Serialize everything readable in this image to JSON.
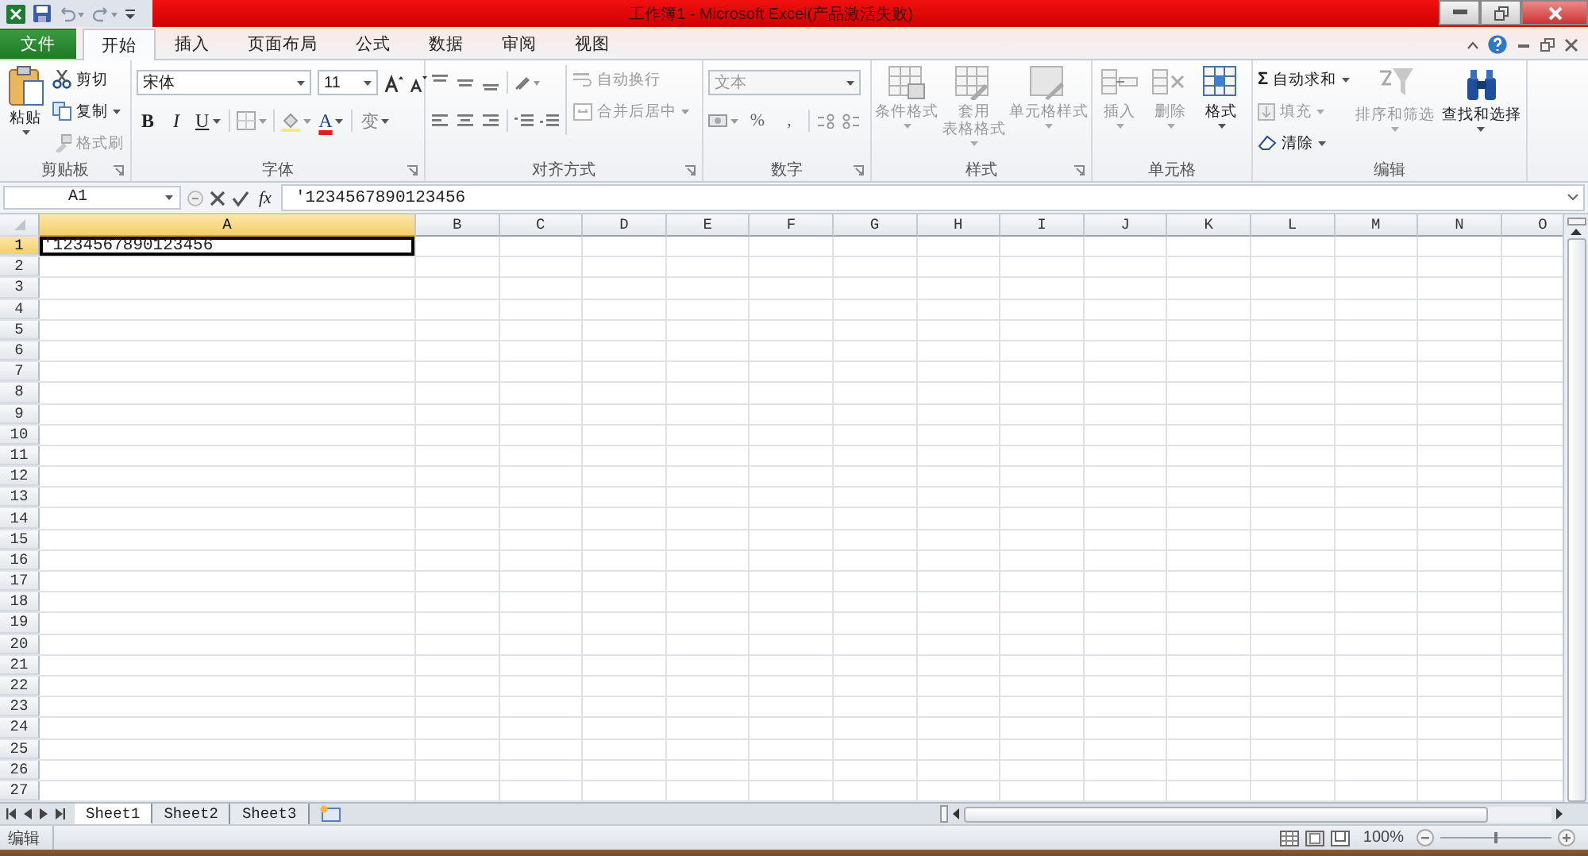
{
  "title_bar": {
    "title": "工作簿1 - Microsoft Excel(产品激活失败)"
  },
  "ribbon_tabs": [
    {
      "label": "文件",
      "kind": "file",
      "selected": false
    },
    {
      "label": "开始",
      "kind": "tab",
      "selected": true
    },
    {
      "label": "插入",
      "kind": "tab",
      "selected": false
    },
    {
      "label": "页面布局",
      "kind": "tab",
      "selected": false
    },
    {
      "label": "公式",
      "kind": "tab",
      "selected": false
    },
    {
      "label": "数据",
      "kind": "tab",
      "selected": false
    },
    {
      "label": "审阅",
      "kind": "tab",
      "selected": false
    },
    {
      "label": "视图",
      "kind": "tab",
      "selected": false
    }
  ],
  "ribbon_groups": [
    {
      "label": "剪贴板",
      "buttons": [
        {
          "label": "粘贴",
          "disabled": false
        },
        {
          "label": "剪切",
          "disabled": false
        },
        {
          "label": "复制",
          "disabled": false
        },
        {
          "label": "格式刷",
          "disabled": true
        }
      ]
    },
    {
      "label": "字体",
      "font": "宋体",
      "size": "11",
      "buttons": [
        {
          "label": "B",
          "kind": "bold"
        },
        {
          "label": "I",
          "kind": "italic"
        },
        {
          "label": "U",
          "kind": "underline"
        },
        {
          "label": "A",
          "kind": "font_color"
        },
        {
          "label": "变",
          "kind": "phonetic"
        }
      ]
    },
    {
      "label": "对齐方式",
      "buttons": [
        {
          "label": "自动换行",
          "disabled": true
        },
        {
          "label": "合并后居中",
          "disabled": true
        }
      ]
    },
    {
      "label": "数字",
      "format": "文本",
      "format_disabled": true,
      "symbols": [
        "%",
        ","
      ]
    },
    {
      "label": "样式",
      "buttons": [
        {
          "lines": [
            "条件格式"
          ],
          "disabled": true
        },
        {
          "lines": [
            "套用",
            "表格格式"
          ],
          "disabled": true
        },
        {
          "lines": [
            "单元格样式"
          ],
          "disabled": true
        }
      ]
    },
    {
      "label": "单元格",
      "buttons": [
        {
          "lines": [
            "插入"
          ],
          "disabled": true
        },
        {
          "lines": [
            "删除"
          ],
          "disabled": true
        },
        {
          "lines": [
            "格式"
          ],
          "disabled": false
        }
      ]
    },
    {
      "label": "编辑",
      "buttons": [
        {
          "label": "自动求和",
          "symbol": "Σ",
          "disabled": false
        },
        {
          "label": "填充",
          "disabled": true
        },
        {
          "label": "清除",
          "disabled": false
        },
        {
          "label": "排序和筛选",
          "disabled": true
        },
        {
          "label": "查找和选择",
          "disabled": false
        }
      ]
    }
  ],
  "formula_bar": {
    "name_box": "A1",
    "function_symbol": "fx",
    "value": "'1234567890123456"
  },
  "columns": [
    {
      "label": "A",
      "selected": true
    },
    {
      "label": "B",
      "selected": false
    },
    {
      "label": "C",
      "selected": false
    },
    {
      "label": "D",
      "selected": false
    },
    {
      "label": "E",
      "selected": false
    },
    {
      "label": "F",
      "selected": false
    },
    {
      "label": "G",
      "selected": false
    },
    {
      "label": "H",
      "selected": false
    },
    {
      "label": "I",
      "selected": false
    },
    {
      "label": "J",
      "selected": false
    },
    {
      "label": "K",
      "selected": false
    },
    {
      "label": "L",
      "selected": false
    },
    {
      "label": "M",
      "selected": false
    },
    {
      "label": "N",
      "selected": false
    },
    {
      "label": "O",
      "selected": false
    }
  ],
  "rows": [
    {
      "label": "1",
      "selected": true,
      "cells": [
        {
          "text": "'1234567890123456",
          "active": true
        }
      ]
    },
    {
      "label": "2",
      "selected": false
    },
    {
      "label": "3",
      "selected": false
    },
    {
      "label": "4",
      "selected": false
    },
    {
      "label": "5",
      "selected": false
    },
    {
      "label": "6",
      "selected": false
    },
    {
      "label": "7",
      "selected": false
    },
    {
      "label": "8",
      "selected": false
    },
    {
      "label": "9",
      "selected": false
    },
    {
      "label": "10",
      "selected": false
    },
    {
      "label": "11",
      "selected": false
    },
    {
      "label": "12",
      "selected": false
    },
    {
      "label": "13",
      "selected": false
    },
    {
      "label": "14",
      "selected": false
    },
    {
      "label": "15",
      "selected": false
    },
    {
      "label": "16",
      "selected": false
    },
    {
      "label": "17",
      "selected": false
    },
    {
      "label": "18",
      "selected": false
    },
    {
      "label": "19",
      "selected": false
    },
    {
      "label": "20",
      "selected": false
    },
    {
      "label": "21",
      "selected": false
    },
    {
      "label": "22",
      "selected": false
    },
    {
      "label": "23",
      "selected": false
    },
    {
      "label": "24",
      "selected": false
    },
    {
      "label": "25",
      "selected": false
    },
    {
      "label": "26",
      "selected": false
    },
    {
      "label": "27",
      "selected": false
    }
  ],
  "sheet_tabs": [
    {
      "label": "Sheet1",
      "selected": true
    },
    {
      "label": "Sheet2",
      "selected": false
    },
    {
      "label": "Sheet3",
      "selected": false
    }
  ],
  "status_bar": {
    "mode": "编辑",
    "zoom": "100%",
    "zoom_slider": {
      "level": 0.5
    }
  }
}
